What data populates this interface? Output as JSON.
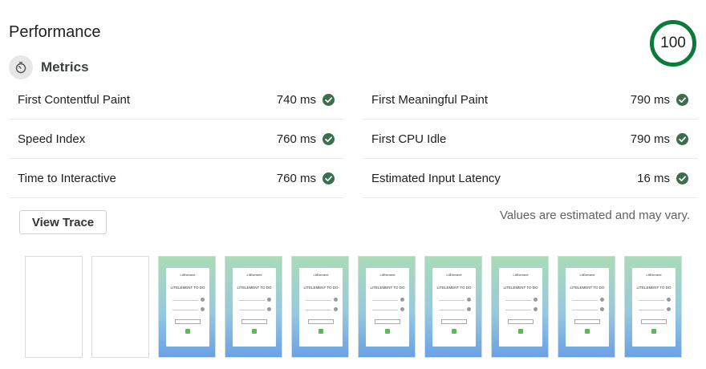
{
  "section": {
    "title": "Performance",
    "score": "100"
  },
  "metrics": {
    "label": "Metrics",
    "left": [
      {
        "name": "First Contentful Paint",
        "value": "740 ms",
        "status": "pass"
      },
      {
        "name": "Speed Index",
        "value": "760 ms",
        "status": "pass"
      },
      {
        "name": "Time to Interactive",
        "value": "760 ms",
        "status": "pass"
      }
    ],
    "right": [
      {
        "name": "First Meaningful Paint",
        "value": "790 ms",
        "status": "pass"
      },
      {
        "name": "First CPU Idle",
        "value": "790 ms",
        "status": "pass"
      },
      {
        "name": "Estimated Input Latency",
        "value": "16 ms",
        "status": "pass"
      }
    ]
  },
  "actions": {
    "view_trace": "View Trace"
  },
  "note": "Values are estimated and may vary.",
  "filmstrip": {
    "frames": [
      "blank",
      "blank",
      "loaded",
      "loaded",
      "loaded",
      "loaded",
      "loaded",
      "loaded",
      "loaded",
      "loaded"
    ],
    "thumb_header": "LitElement",
    "thumb_title": "LITELEMENT TO DO"
  },
  "colors": {
    "pass": "#0b7a3b",
    "check": "#3b6e4d",
    "score_ring": "#0b7a3b"
  },
  "icons": {
    "metrics": "timer-icon",
    "pass": "check-circle-icon"
  }
}
